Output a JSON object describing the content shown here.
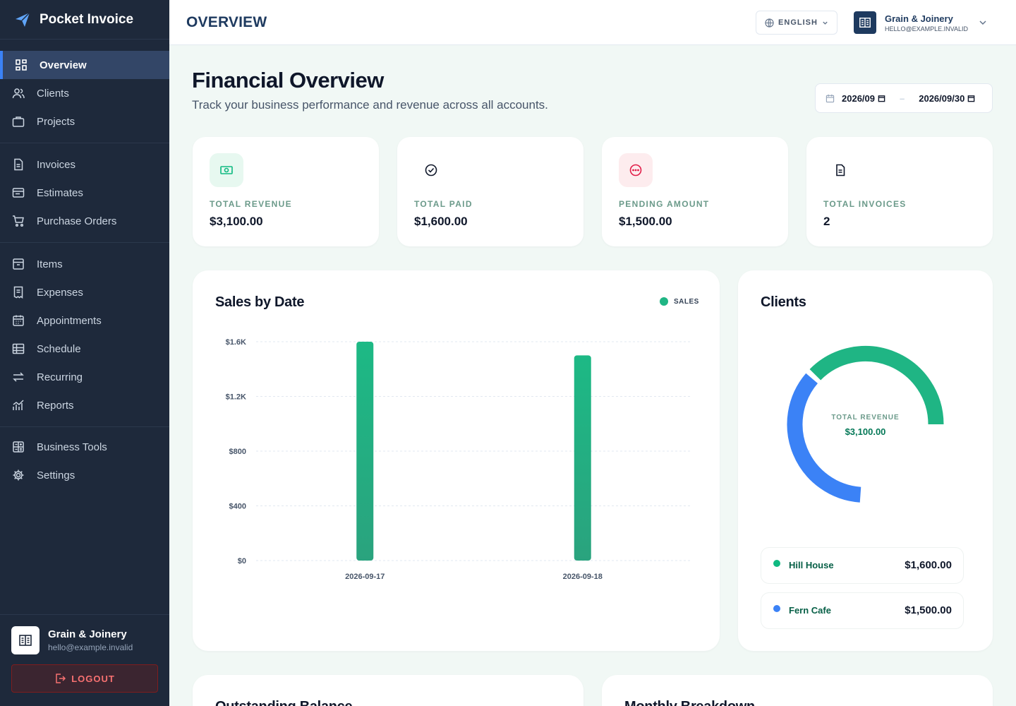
{
  "app": {
    "name": "Pocket Invoice"
  },
  "sidebar": {
    "groups": [
      [
        {
          "label": "Overview",
          "icon": "grid-icon",
          "active": true
        },
        {
          "label": "Clients",
          "icon": "users-icon"
        },
        {
          "label": "Projects",
          "icon": "briefcase-icon"
        }
      ],
      [
        {
          "label": "Invoices",
          "icon": "document-icon"
        },
        {
          "label": "Estimates",
          "icon": "folder-icon"
        },
        {
          "label": "Purchase Orders",
          "icon": "cart-icon"
        }
      ],
      [
        {
          "label": "Items",
          "icon": "archive-icon"
        },
        {
          "label": "Expenses",
          "icon": "receipt-icon"
        },
        {
          "label": "Appointments",
          "icon": "calendar-icon"
        },
        {
          "label": "Schedule",
          "icon": "table-icon"
        },
        {
          "label": "Recurring",
          "icon": "repeat-icon"
        },
        {
          "label": "Reports",
          "icon": "chart-icon"
        }
      ],
      [
        {
          "label": "Business Tools",
          "icon": "calculator-icon"
        },
        {
          "label": "Settings",
          "icon": "gear-icon"
        }
      ]
    ],
    "footer": {
      "name": "Grain & Joinery",
      "email": "hello@example.invalid",
      "logout_label": "LOGOUT"
    }
  },
  "topbar": {
    "title": "OVERVIEW",
    "language": "ENGLISH",
    "company": {
      "name": "Grain & Joinery",
      "email": "HELLO@EXAMPLE.INVALID"
    }
  },
  "header": {
    "title": "Financial Overview",
    "subtitle": "Track your business performance and revenue across all accounts.",
    "date_from": "2026/09",
    "date_to": "2026/09/30"
  },
  "stats": [
    {
      "label": "TOTAL REVENUE",
      "value": "$3,100.00",
      "icon": "cash-icon",
      "bg": "#e7f8f0",
      "color": "#10b981"
    },
    {
      "label": "TOTAL PAID",
      "value": "$1,600.00",
      "icon": "check-circle-icon",
      "bg": "#ffffff",
      "color": "#0f172a"
    },
    {
      "label": "PENDING AMOUNT",
      "value": "$1,500.00",
      "icon": "dots-circle-icon",
      "bg": "#fdecee",
      "color": "#e11d48"
    },
    {
      "label": "TOTAL INVOICES",
      "value": "2",
      "icon": "file-icon",
      "bg": "#ffffff",
      "color": "#0f172a"
    }
  ],
  "sales_panel": {
    "title": "Sales by Date"
  },
  "chart_data": {
    "type": "bar",
    "title": "Sales by Date",
    "categories": [
      "2026-09-17",
      "2026-09-18"
    ],
    "series": [
      {
        "name": "SALES",
        "values": [
          1600,
          1500
        ],
        "color": "#1fb584"
      }
    ],
    "yticks": [
      "$0",
      "$400",
      "$800",
      "$1.2K",
      "$1.6K"
    ],
    "ytick_values": [
      0,
      400,
      800,
      1200,
      1600
    ],
    "ylim": [
      0,
      1600
    ],
    "grid": true,
    "legend_position": "top-right"
  },
  "clients_panel": {
    "title": "Clients",
    "center_label": "TOTAL REVENUE",
    "center_value": "$3,100.00",
    "donut": [
      {
        "name": "Hill House",
        "value": 1600,
        "color": "#1fb584"
      },
      {
        "name": "Fern Cafe",
        "value": 1500,
        "color": "#3b82f6"
      }
    ],
    "list": [
      {
        "name": "Hill House",
        "amount": "$1,600.00",
        "color": "#10b981"
      },
      {
        "name": "Fern Cafe",
        "amount": "$1,500.00",
        "color": "#3b82f6"
      }
    ]
  },
  "bottom_panels": {
    "left_title": "Outstanding Balance",
    "right_title": "Monthly Breakdown"
  }
}
